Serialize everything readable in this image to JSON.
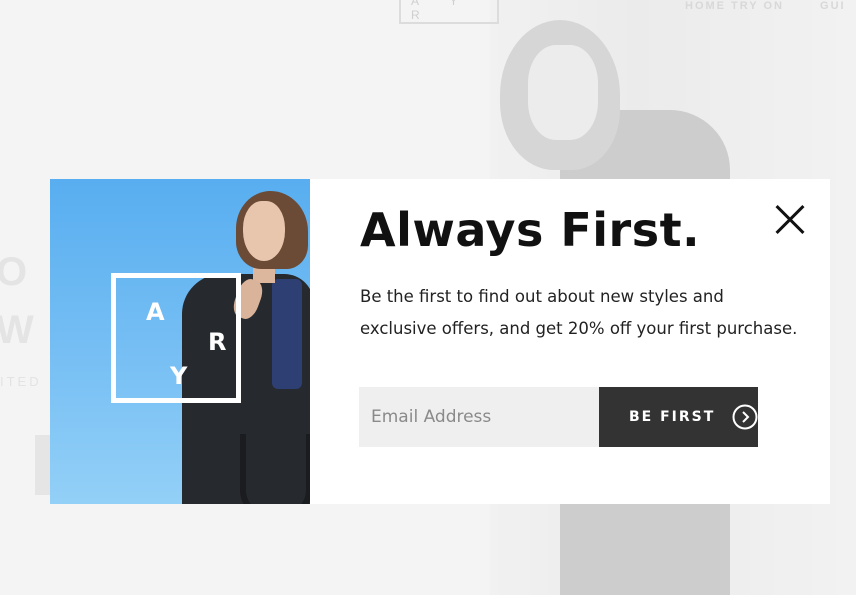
{
  "background": {
    "logo": "A Y R",
    "nav": [
      "HOME TRY ON",
      "GUI"
    ],
    "hero_lines": [
      "O",
      "W A"
    ],
    "sub": "ITED"
  },
  "modal": {
    "brand_letters": {
      "a": "A",
      "r": "R",
      "y": "Y"
    },
    "title": "Always First.",
    "description": "Be the first to find out about new styles and exclusive offers, and get 20% off your first purchase.",
    "email_placeholder": "Email Address",
    "submit_label": "BE FIRST",
    "icons": {
      "close": "close-icon",
      "submit": "chevron-right-circle-icon"
    }
  }
}
